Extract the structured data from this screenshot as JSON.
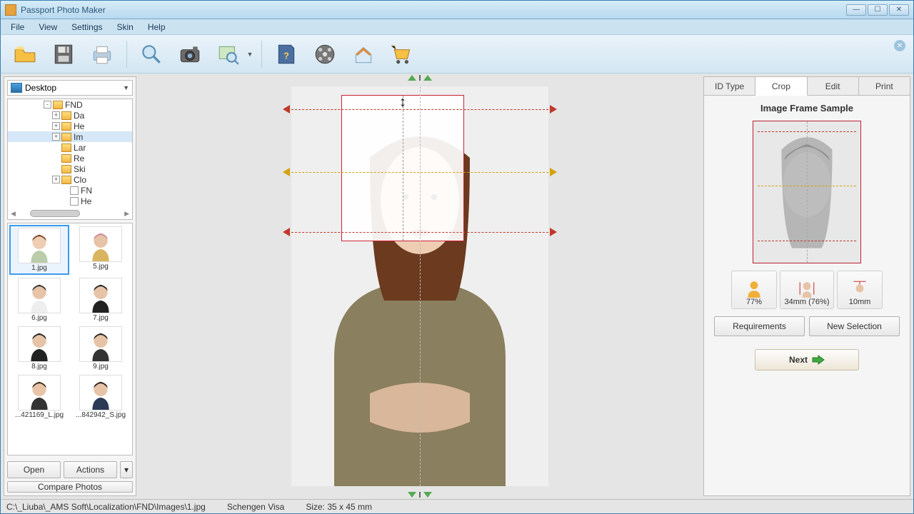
{
  "window": {
    "title": "Passport Photo Maker"
  },
  "menubar": [
    "File",
    "View",
    "Settings",
    "Skin",
    "Help"
  ],
  "toolbar": {
    "items": [
      "open",
      "save",
      "print",
      "search",
      "camera",
      "zoom",
      "help",
      "video",
      "home",
      "cart"
    ]
  },
  "sidebar": {
    "location_label": "Desktop",
    "tree": [
      {
        "indent": 50,
        "exp": "-",
        "label": "FND"
      },
      {
        "indent": 62,
        "exp": "+",
        "label": "Da"
      },
      {
        "indent": 62,
        "exp": "+",
        "label": "He"
      },
      {
        "indent": 62,
        "exp": "+",
        "label": "Im",
        "selected": true
      },
      {
        "indent": 62,
        "exp": "",
        "label": "Lar"
      },
      {
        "indent": 62,
        "exp": "",
        "label": "Re"
      },
      {
        "indent": 62,
        "exp": "",
        "label": "Ski"
      },
      {
        "indent": 62,
        "exp": "+",
        "label": "Clo"
      },
      {
        "indent": 74,
        "exp": "",
        "label": "FN",
        "file": true
      },
      {
        "indent": 74,
        "exp": "",
        "label": "He",
        "file": true
      }
    ],
    "thumbs": [
      {
        "label": "1.jpg",
        "selected": true
      },
      {
        "label": "5.jpg"
      },
      {
        "label": "6.jpg"
      },
      {
        "label": "7.jpg"
      },
      {
        "label": "8.jpg"
      },
      {
        "label": "9.jpg"
      },
      {
        "label": "...421169_L.jpg"
      },
      {
        "label": "...842942_S.jpg"
      }
    ],
    "open_label": "Open",
    "actions_label": "Actions",
    "compare_label": "Compare Photos"
  },
  "tabs": {
    "id_type": "ID Type",
    "crop": "Crop",
    "edit": "Edit",
    "print": "Print",
    "active": "crop"
  },
  "crop_panel": {
    "sample_title": "Image Frame Sample",
    "metrics": [
      {
        "value": "77%"
      },
      {
        "value": "34mm (76%)"
      },
      {
        "value": "10mm"
      }
    ],
    "requirements_label": "Requirements",
    "new_selection_label": "New Selection",
    "next_label": "Next"
  },
  "status": {
    "path": "C:\\_Liuba\\_AMS Soft\\Localization\\FND\\Images\\1.jpg",
    "doc_type": "Schengen Visa",
    "size": "Size: 35 x 45 mm"
  },
  "colors": {
    "crop_border": "#c0392b",
    "guide_red": "#c0392b",
    "guide_yellow": "#d4a20a",
    "guide_green": "#2e8b2e"
  }
}
